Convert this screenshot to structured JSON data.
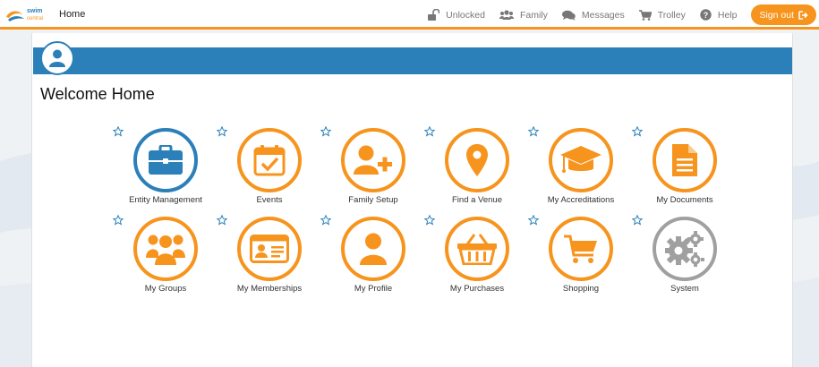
{
  "brand": {
    "name": "swim central",
    "accent": "#f7941d",
    "primary": "#2b80b9",
    "neutral": "#a0a0a0"
  },
  "topbar": {
    "home_label": "Home",
    "nav": [
      {
        "label": "Unlocked",
        "icon": "unlock-icon"
      },
      {
        "label": "Family",
        "icon": "users-icon"
      },
      {
        "label": "Messages",
        "icon": "comments-icon"
      },
      {
        "label": "Trolley",
        "icon": "cart-icon"
      },
      {
        "label": "Help",
        "icon": "question-circle-icon"
      }
    ],
    "signout_label": "Sign out"
  },
  "page": {
    "title": "Welcome Home"
  },
  "tiles": [
    {
      "label": "Entity Management",
      "icon": "briefcase-icon",
      "color": "#2b80b9"
    },
    {
      "label": "Events",
      "icon": "calendar-check-icon",
      "color": "#f7941d"
    },
    {
      "label": "Family Setup",
      "icon": "user-plus-icon",
      "color": "#f7941d"
    },
    {
      "label": "Find a Venue",
      "icon": "map-marker-icon",
      "color": "#f7941d"
    },
    {
      "label": "My Accreditations",
      "icon": "graduation-cap-icon",
      "color": "#f7941d"
    },
    {
      "label": "My Documents",
      "icon": "document-icon",
      "color": "#f7941d"
    },
    {
      "label": "My Groups",
      "icon": "group-icon",
      "color": "#f7941d"
    },
    {
      "label": "My Memberships",
      "icon": "id-card-icon",
      "color": "#f7941d"
    },
    {
      "label": "My Profile",
      "icon": "user-icon",
      "color": "#f7941d"
    },
    {
      "label": "My Purchases",
      "icon": "basket-icon",
      "color": "#f7941d"
    },
    {
      "label": "Shopping",
      "icon": "shopping-cart-icon",
      "color": "#f7941d"
    },
    {
      "label": "System",
      "icon": "cogs-icon",
      "color": "#a0a0a0"
    }
  ]
}
